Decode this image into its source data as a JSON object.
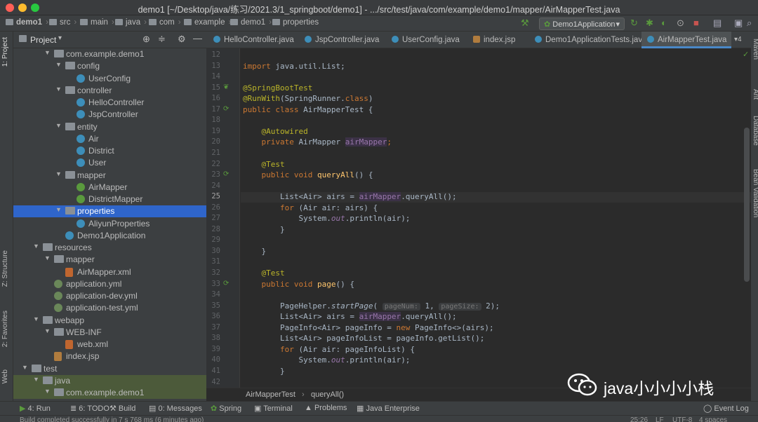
{
  "window": {
    "title": "demo1 [~/Desktop/java/练习/2021.3/1_springboot/demo1] - .../src/test/java/com/example/demo1/mapper/AirMapperTest.java"
  },
  "breadcrumb": [
    "demo1",
    "src",
    "main",
    "java",
    "com",
    "example",
    "demo1",
    "properties"
  ],
  "run_config": "Demo1Application",
  "left_strip": {
    "project": "1: Project",
    "structure": "Z: Structure",
    "favorites": "2: Favorites",
    "web": "Web"
  },
  "right_strip": {
    "maven": "Maven",
    "ant": "Ant",
    "database": "Database",
    "bean": "Bean Validation"
  },
  "project_panel": {
    "title": "Project"
  },
  "tree": [
    {
      "label": "com.example.demo1",
      "level": 3,
      "icon": "folder-icon",
      "arrow": "▼"
    },
    {
      "label": "config",
      "level": 4,
      "icon": "folder-icon",
      "arrow": "▼"
    },
    {
      "label": "UserConfig",
      "level": 5,
      "icon": "class-icon",
      "arrow": ""
    },
    {
      "label": "controller",
      "level": 4,
      "icon": "folder-icon",
      "arrow": "▼"
    },
    {
      "label": "HelloController",
      "level": 5,
      "icon": "class-icon",
      "arrow": ""
    },
    {
      "label": "JspController",
      "level": 5,
      "icon": "class-icon",
      "arrow": ""
    },
    {
      "label": "entity",
      "level": 4,
      "icon": "folder-icon",
      "arrow": "▼"
    },
    {
      "label": "Air",
      "level": 5,
      "icon": "class-icon",
      "arrow": ""
    },
    {
      "label": "District",
      "level": 5,
      "icon": "class-icon",
      "arrow": ""
    },
    {
      "label": "User",
      "level": 5,
      "icon": "class-icon",
      "arrow": ""
    },
    {
      "label": "mapper",
      "level": 4,
      "icon": "folder-icon",
      "arrow": "▼"
    },
    {
      "label": "AirMapper",
      "level": 5,
      "icon": "interface-icon",
      "arrow": ""
    },
    {
      "label": "DistrictMapper",
      "level": 5,
      "icon": "interface-icon",
      "arrow": ""
    },
    {
      "label": "properties",
      "level": 4,
      "icon": "folder-icon",
      "arrow": "▼",
      "selected": true
    },
    {
      "label": "AliyunProperties",
      "level": 5,
      "icon": "class-icon",
      "arrow": ""
    },
    {
      "label": "Demo1Application",
      "level": 4,
      "icon": "class-icon",
      "arrow": ""
    },
    {
      "label": "resources",
      "level": 2,
      "icon": "folder-icon",
      "arrow": "▼"
    },
    {
      "label": "mapper",
      "level": 3,
      "icon": "folder-icon",
      "arrow": "▼"
    },
    {
      "label": "AirMapper.xml",
      "level": 4,
      "icon": "xml-icon",
      "arrow": ""
    },
    {
      "label": "application.yml",
      "level": 3,
      "icon": "yml-icon",
      "arrow": ""
    },
    {
      "label": "application-dev.yml",
      "level": 3,
      "icon": "yml-icon",
      "arrow": ""
    },
    {
      "label": "application-test.yml",
      "level": 3,
      "icon": "yml-icon",
      "arrow": ""
    },
    {
      "label": "webapp",
      "level": 2,
      "icon": "folder-icon",
      "arrow": "▼"
    },
    {
      "label": "WEB-INF",
      "level": 3,
      "icon": "folder-icon",
      "arrow": "▼"
    },
    {
      "label": "web.xml",
      "level": 4,
      "icon": "xml-icon",
      "arrow": ""
    },
    {
      "label": "index.jsp",
      "level": 3,
      "icon": "jsp-icon",
      "arrow": ""
    },
    {
      "label": "test",
      "level": 1,
      "icon": "folder-icon",
      "arrow": "▼"
    },
    {
      "label": "java",
      "level": 2,
      "icon": "folder-icon",
      "arrow": "▼",
      "green": true
    },
    {
      "label": "com.example.demo1",
      "level": 3,
      "icon": "folder-icon",
      "arrow": "▼",
      "green": true
    }
  ],
  "tabs": [
    {
      "label": "HelloController.java",
      "active": false
    },
    {
      "label": "JspController.java",
      "active": false
    },
    {
      "label": "UserConfig.java",
      "active": false
    },
    {
      "label": "index.jsp",
      "active": false
    },
    {
      "label": "Demo1ApplicationTests.java",
      "active": false
    },
    {
      "label": "AirMapperTest.java",
      "active": true
    }
  ],
  "tabs_overflow": "4",
  "line_numbers": [
    "12",
    "13",
    "14",
    "15",
    "16",
    "17",
    "18",
    "19",
    "20",
    "21",
    "22",
    "23",
    "24",
    "25",
    "26",
    "27",
    "28",
    "29",
    "30",
    "31",
    "32",
    "33",
    "34",
    "35",
    "36",
    "37",
    "38",
    "39",
    "40",
    "41",
    "42"
  ],
  "current_line": "25",
  "code_lines": [
    [],
    [
      {
        "t": "kw",
        "v": "import "
      },
      {
        "t": "ty",
        "v": "java.util.List;"
      }
    ],
    [],
    [
      {
        "t": "an",
        "v": "@SpringBootTest"
      }
    ],
    [
      {
        "t": "an",
        "v": "@RunWith"
      },
      {
        "t": "ty",
        "v": "(SpringRunner."
      },
      {
        "t": "kw",
        "v": "class"
      },
      {
        "t": "ty",
        "v": ")"
      }
    ],
    [
      {
        "t": "kw",
        "v": "public class "
      },
      {
        "t": "ty",
        "v": "AirMapperTest {"
      }
    ],
    [],
    [
      {
        "t": "ty",
        "v": "    "
      },
      {
        "t": "an",
        "v": "@Autowired"
      }
    ],
    [
      {
        "t": "ty",
        "v": "    "
      },
      {
        "t": "kw",
        "v": "private "
      },
      {
        "t": "ty",
        "v": "AirMapper "
      },
      {
        "t": "fd",
        "v": "airMapper"
      },
      {
        "t": "kw",
        "v": ";"
      }
    ],
    [],
    [
      {
        "t": "ty",
        "v": "    "
      },
      {
        "t": "an",
        "v": "@Test"
      }
    ],
    [
      {
        "t": "ty",
        "v": "    "
      },
      {
        "t": "kw",
        "v": "public void "
      },
      {
        "t": "fn",
        "v": "queryAll"
      },
      {
        "t": "ty",
        "v": "() {"
      }
    ],
    [],
    [
      {
        "t": "ty",
        "v": "        List<Air> airs = "
      },
      {
        "t": "fd",
        "v": "airMapper"
      },
      {
        "t": "ty",
        "v": ".queryAll();"
      }
    ],
    [
      {
        "t": "ty",
        "v": "        "
      },
      {
        "t": "kw",
        "v": "for "
      },
      {
        "t": "ty",
        "v": "(Air air: airs) {"
      }
    ],
    [
      {
        "t": "ty",
        "v": "            System."
      },
      {
        "t": "st",
        "v": "out"
      },
      {
        "t": "ty",
        "v": ".println(air);"
      }
    ],
    [
      {
        "t": "ty",
        "v": "        }"
      }
    ],
    [],
    [
      {
        "t": "ty",
        "v": "    }"
      }
    ],
    [],
    [
      {
        "t": "ty",
        "v": "    "
      },
      {
        "t": "an",
        "v": "@Test"
      }
    ],
    [
      {
        "t": "ty",
        "v": "    "
      },
      {
        "t": "kw",
        "v": "public void "
      },
      {
        "t": "fn",
        "v": "page"
      },
      {
        "t": "ty",
        "v": "() {"
      }
    ],
    [],
    [
      {
        "t": "ty",
        "v": "        PageHelper."
      },
      {
        "t": "it",
        "v": "startPage"
      },
      {
        "t": "ty",
        "v": "( "
      },
      {
        "t": "hint",
        "v": "pageNum:"
      },
      {
        "t": "ty",
        "v": " 1, "
      },
      {
        "t": "hint",
        "v": "pageSize:"
      },
      {
        "t": "ty",
        "v": " 2);"
      }
    ],
    [
      {
        "t": "ty",
        "v": "        List<Air> airs = "
      },
      {
        "t": "fd",
        "v": "airMapper"
      },
      {
        "t": "ty",
        "v": ".queryAll();"
      }
    ],
    [
      {
        "t": "ty",
        "v": "        PageInfo<Air> pageInfo = "
      },
      {
        "t": "kw",
        "v": "new "
      },
      {
        "t": "ty",
        "v": "PageInfo<>(airs);"
      }
    ],
    [
      {
        "t": "ty",
        "v": "        List<Air> pageInfoList = pageInfo.getList();"
      }
    ],
    [
      {
        "t": "ty",
        "v": "        "
      },
      {
        "t": "kw",
        "v": "for "
      },
      {
        "t": "ty",
        "v": "(Air air: pageInfoList) {"
      }
    ],
    [
      {
        "t": "ty",
        "v": "            System."
      },
      {
        "t": "st",
        "v": "out"
      },
      {
        "t": "ty",
        "v": ".println(air);"
      }
    ],
    [
      {
        "t": "ty",
        "v": "        }"
      }
    ],
    []
  ],
  "editor_breadcrumb": {
    "class_name": "AirMapperTest",
    "method": "queryAll()"
  },
  "tool_windows": [
    "4: Run",
    "6: TODO",
    "Build",
    "0: Messages",
    "Spring",
    "Terminal",
    "Problems",
    "Java Enterprise"
  ],
  "event_log": "Event Log",
  "status": {
    "message": "Build completed successfully in 7 s 768 ms (6 minutes ago)",
    "position": "25:26",
    "line_sep": "LF",
    "encoding": "UTF-8",
    "indent": "4 spaces"
  },
  "watermark": "java小小小小栈",
  "colors": {
    "selection": "#2f65ca",
    "bg": "#2b2b2b",
    "panel": "#3c3f41",
    "keyword": "#cc7832",
    "annotation": "#bbb529",
    "field": "#9876aa",
    "method": "#ffc66d"
  }
}
